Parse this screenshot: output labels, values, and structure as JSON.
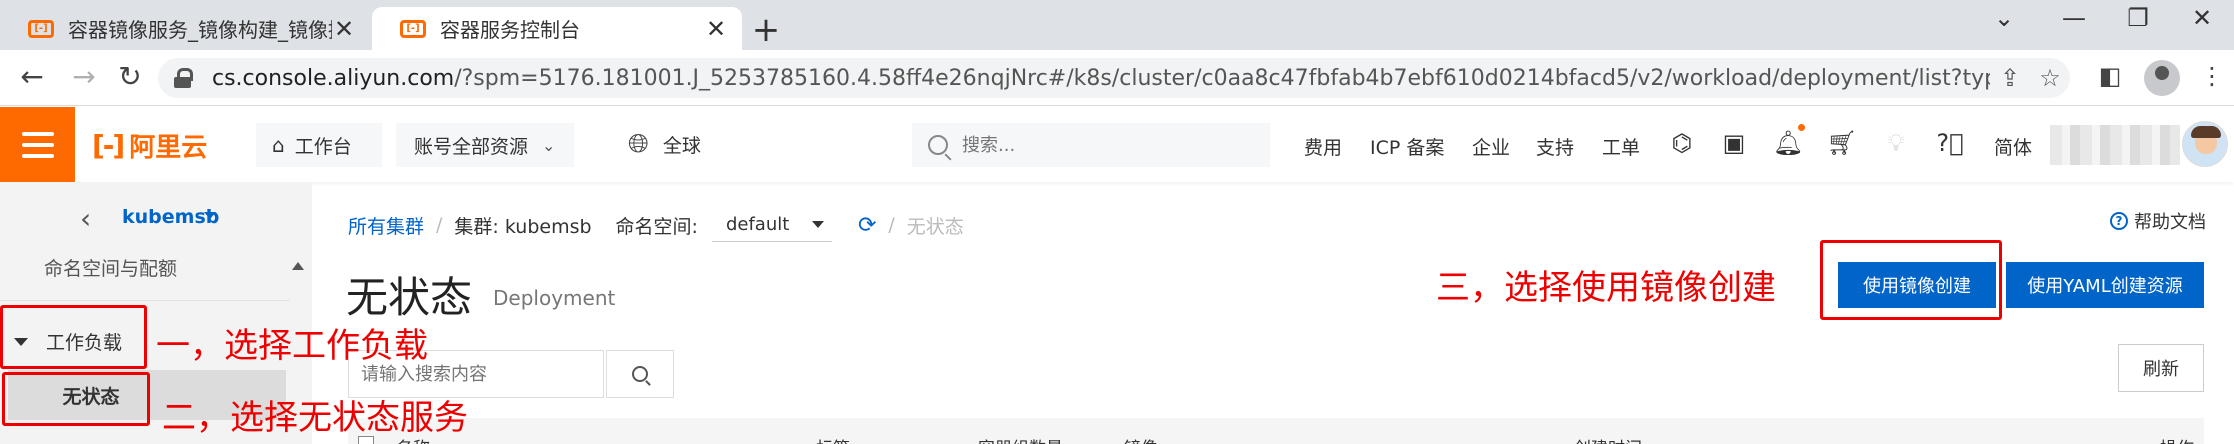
{
  "browser": {
    "tabs": [
      {
        "title": "容器镜像服务_镜像构建_镜像授权",
        "active": false
      },
      {
        "title": "容器服务控制台",
        "active": true
      }
    ],
    "new_tab": "+",
    "url_host": "cs.console.aliyun.com",
    "url_rest": "/?spm=5176.181001.J_5253785160.4.58ff4e26nqjNrc#/k8s/cluster/c0aa8c47fbfab4b7ebf610d0214bfacd5/v2/workload/deployment/list?type=deployme..."
  },
  "console": {
    "logo_text": "阿里云",
    "workbench": "工作台",
    "account_resources": "账号全部资源",
    "region": "全球",
    "search_placeholder": "搜索...",
    "links": {
      "billing": "费用",
      "icp": "ICP 备案",
      "enterprise": "企业",
      "support": "支持",
      "ticket": "工单",
      "lang": "简体"
    }
  },
  "sidebar": {
    "cluster_name": "kubemsb",
    "namespace_quota": "命名空间与配额",
    "workload": "工作负载",
    "stateless": "无状态"
  },
  "breadcrumb": {
    "all_clusters": "所有集群",
    "cluster": "集群: kubemsb",
    "namespace_label": "命名空间:",
    "namespace_value": "default",
    "current": "无状态"
  },
  "help_doc": "帮助文档",
  "page": {
    "title": "无状态",
    "subtitle": "Deployment"
  },
  "actions": {
    "create_from_image": "使用镜像创建",
    "create_from_yaml": "使用YAML创建资源",
    "refresh": "刷新",
    "search_placeholder": "请输入搜索内容"
  },
  "table": {
    "columns": [
      "名称",
      "标签",
      "容器组数量",
      "镜像",
      "创建时间",
      "操作"
    ]
  },
  "annotations": {
    "step1": "一，选择工作负载",
    "step2": "二，选择无状态服务",
    "step3": "三，选择使用镜像创建",
    "color": "#e00000"
  },
  "colors": {
    "brand_orange": "#ff6a00",
    "primary_blue": "#0064c8"
  }
}
